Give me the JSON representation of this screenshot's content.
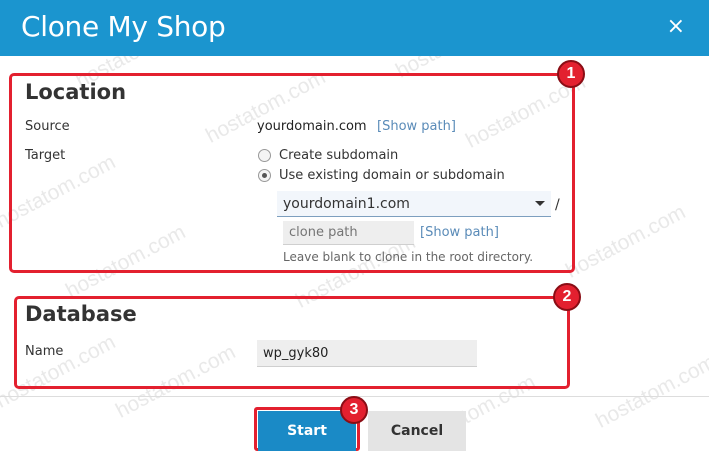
{
  "header": {
    "title": "Clone My Shop",
    "close_glyph": "×"
  },
  "watermark": "hostatom.com",
  "location": {
    "title": "Location",
    "badge": "1",
    "source_label": "Source",
    "source_value": "yourdomain.com",
    "source_show_path": "[Show path]",
    "target_label": "Target",
    "option_subdomain": "Create subdomain",
    "option_existing": "Use existing domain or subdomain",
    "selected_option": "Use existing domain or subdomain",
    "domain_select_value": "yourdomain1.com",
    "slash": "/",
    "path_placeholder": "clone path",
    "path_show_path": "[Show path]",
    "hint": "Leave blank to clone in the root directory."
  },
  "database": {
    "title": "Database",
    "badge": "2",
    "name_label": "Name",
    "name_value": "wp_gyk80"
  },
  "footer": {
    "start_label": "Start",
    "start_badge": "3",
    "cancel_label": "Cancel"
  },
  "colors": {
    "header_bg": "#1b95cf",
    "annotation_red": "#e3202f",
    "primary_button": "#1a8ac6",
    "link": "#5a8bb8"
  }
}
